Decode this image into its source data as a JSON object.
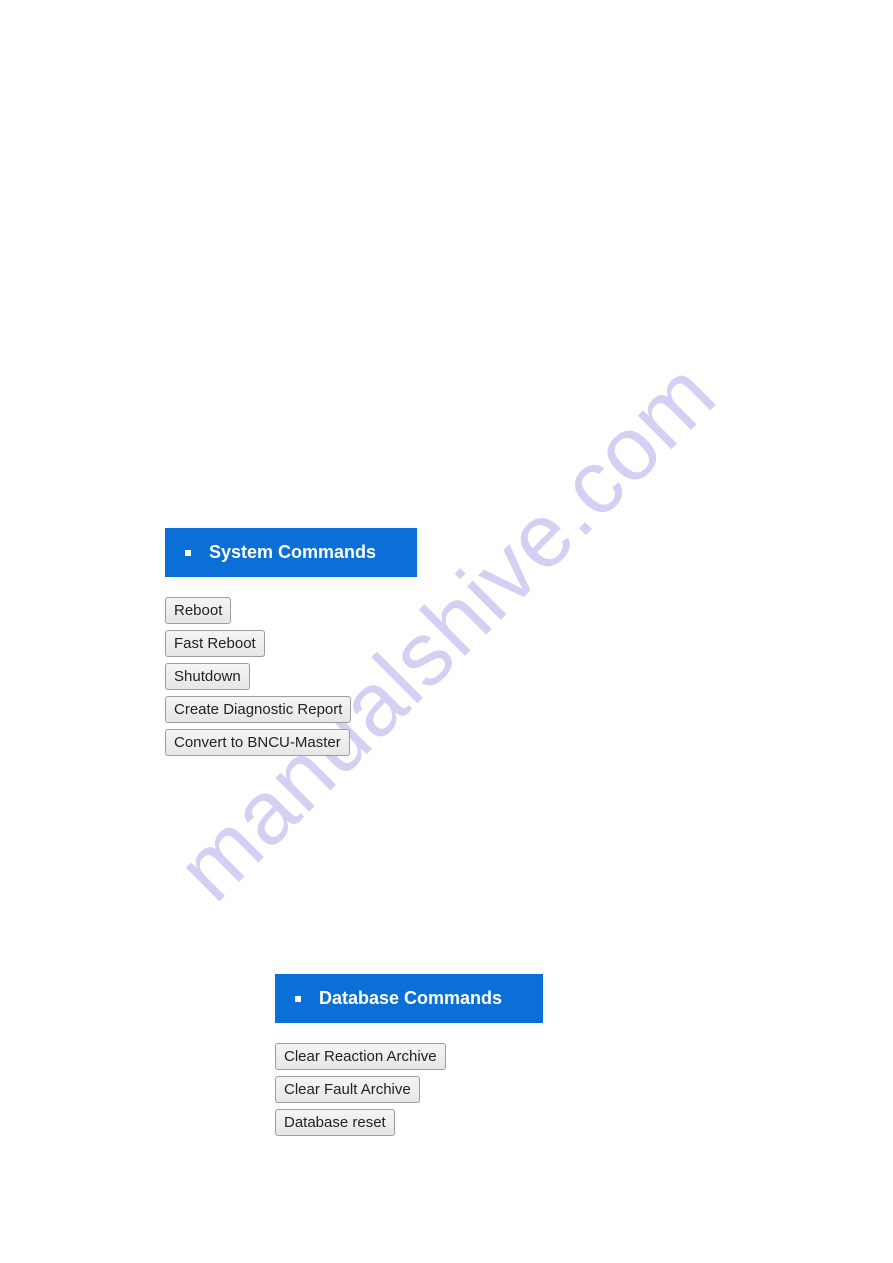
{
  "watermark": "manualshive.com",
  "sections": {
    "system": {
      "title": "System Commands",
      "buttons": [
        "Reboot",
        "Fast Reboot",
        "Shutdown",
        "Create Diagnostic Report",
        "Convert to BNCU-Master"
      ]
    },
    "database": {
      "title": "Database Commands",
      "buttons": [
        "Clear Reaction Archive",
        "Clear Fault Archive",
        "Database reset"
      ]
    }
  }
}
